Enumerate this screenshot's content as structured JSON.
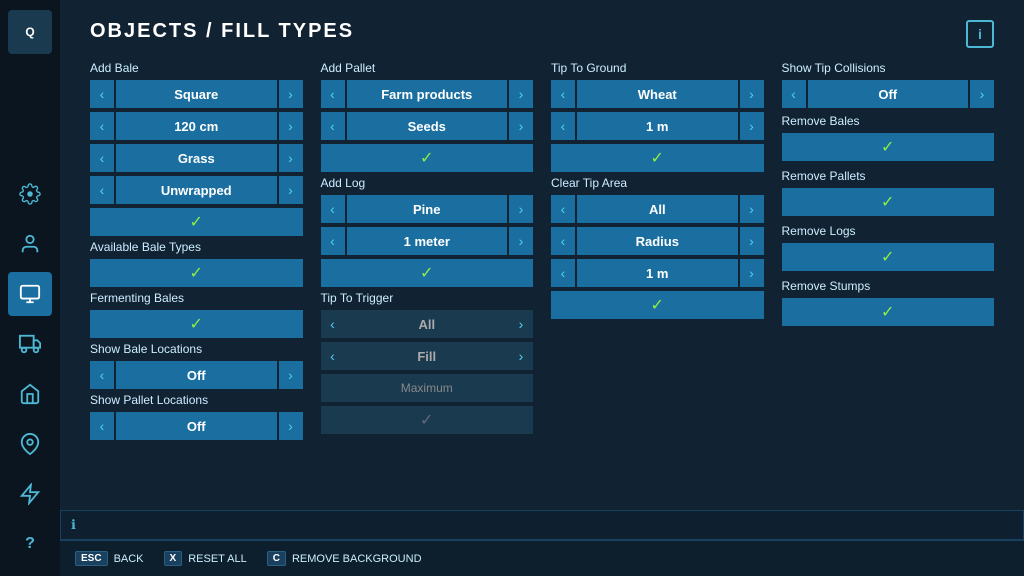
{
  "sidebar": {
    "icons": [
      {
        "name": "q-icon",
        "label": "Q",
        "type": "text"
      },
      {
        "name": "settings-icon",
        "label": "⚙",
        "type": "text"
      },
      {
        "name": "person-icon",
        "label": "👤",
        "type": "text"
      },
      {
        "name": "storage-icon",
        "label": "📦",
        "type": "text",
        "active": true
      },
      {
        "name": "vehicle-icon",
        "label": "🚗",
        "type": "text"
      },
      {
        "name": "farm-icon",
        "label": "🏠",
        "type": "text"
      },
      {
        "name": "map-icon",
        "label": "📍",
        "type": "text"
      },
      {
        "name": "weather-icon",
        "label": "🌊",
        "type": "text"
      },
      {
        "name": "help-icon",
        "label": "?",
        "type": "text"
      }
    ]
  },
  "page": {
    "title": "OBJECTS / FILL TYPES",
    "info_icon": "i"
  },
  "add_bale": {
    "label": "Add Bale",
    "shape": {
      "value": "Square"
    },
    "size": {
      "value": "120 cm"
    },
    "type": {
      "value": "Grass"
    },
    "wrap": {
      "value": "Unwrapped"
    },
    "check1": "✓",
    "avail_label": "Available Bale Types",
    "check2": "✓",
    "ferm_label": "Fermenting Bales",
    "check3": "✓",
    "show_bale_label": "Show Bale Locations",
    "show_bale_val": "Off",
    "show_pallet_label": "Show Pallet Locations",
    "show_pallet_val": "Off"
  },
  "add_pallet": {
    "label": "Add Pallet",
    "type1": {
      "value": "Farm products"
    },
    "type2": {
      "value": "Seeds"
    },
    "check": "✓",
    "log_label": "Add Log",
    "log_type": {
      "value": "Pine"
    },
    "log_size": {
      "value": "1 meter"
    },
    "log_check": "✓",
    "trigger_label": "Tip To Trigger",
    "trig1": {
      "value": "All"
    },
    "trig2": {
      "value": "Fill"
    },
    "trig_max": "Maximum",
    "trig_check": "✓"
  },
  "tip_ground": {
    "label": "Tip To Ground",
    "fill_type": {
      "value": "Wheat"
    },
    "distance": {
      "value": "1 m"
    },
    "check1": "✓",
    "clear_label": "Clear Tip Area",
    "clear_all": {
      "value": "All"
    },
    "clear_radius": {
      "value": "Radius"
    },
    "clear_dist": {
      "value": "1 m"
    },
    "check2": "✓"
  },
  "tip_collisions": {
    "label": "Show Tip Collisions",
    "value": {
      "value": "Off"
    },
    "remove_bales": "Remove Bales",
    "check_bales": "✓",
    "remove_pallets": "Remove Pallets",
    "check_pallets": "✓",
    "remove_logs": "Remove Logs",
    "check_logs": "✓",
    "remove_stumps": "Remove Stumps",
    "check_stumps": "✓"
  },
  "bottom": {
    "back_key": "ESC",
    "back_label": "BACK",
    "reset_key": "X",
    "reset_label": "RESET ALL",
    "bg_key": "C",
    "bg_label": "REMOVE BACKGROUND"
  }
}
